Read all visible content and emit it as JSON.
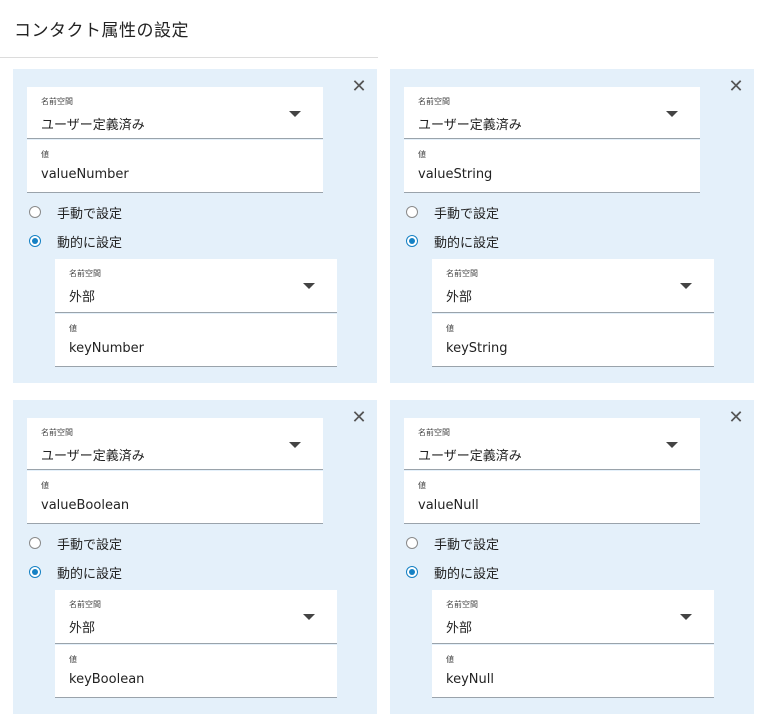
{
  "page": {
    "title": "コンタクト属性の設定"
  },
  "labels": {
    "namespace": "名前空間",
    "value": "値",
    "manual": "手動で設定",
    "dynamic": "動的に設定",
    "close": "✕"
  },
  "cards": [
    {
      "namespace": "ユーザー定義済み",
      "value": "valueNumber",
      "mode": "dynamic",
      "sub_namespace": "外部",
      "sub_value": "keyNumber"
    },
    {
      "namespace": "ユーザー定義済み",
      "value": "valueString",
      "mode": "dynamic",
      "sub_namespace": "外部",
      "sub_value": "keyString"
    },
    {
      "namespace": "ユーザー定義済み",
      "value": "valueBoolean",
      "mode": "dynamic",
      "sub_namespace": "外部",
      "sub_value": "keyBoolean"
    },
    {
      "namespace": "ユーザー定義済み",
      "value": "valueNull",
      "mode": "dynamic",
      "sub_namespace": "外部",
      "sub_value": "keyNull"
    }
  ],
  "colors": {
    "card_bg": "#e4f0fa",
    "accent": "#1581c4"
  }
}
